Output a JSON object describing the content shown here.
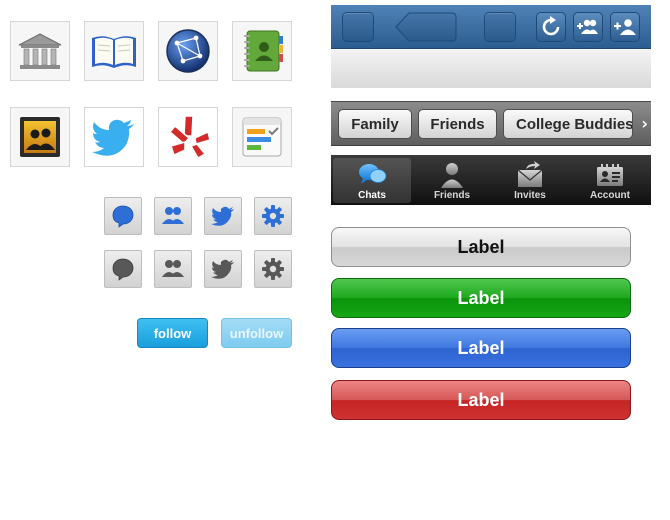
{
  "follow_buttons": {
    "follow": "follow",
    "unfollow": "unfollow"
  },
  "segments": [
    "Family",
    "Friends",
    "College Buddies"
  ],
  "tabs": [
    "Chats",
    "Friends",
    "Invites",
    "Account"
  ],
  "buttons": {
    "gray": "Label",
    "green": "Label",
    "blue": "Label",
    "red": "Label"
  },
  "colors": {
    "nav_blue": "#3a6ca0",
    "follow_blue": "#1a9fdd",
    "green": "#1ea81e",
    "blue": "#3f77e0",
    "red": "#c52424"
  },
  "icons": {
    "app_row_1": [
      "bank-icon",
      "book-icon",
      "network-globe-icon",
      "address-book-icon"
    ],
    "app_row_2": [
      "contacts-photo-icon",
      "twitter-bird-icon",
      "yelp-icon",
      "options-settings-icon"
    ],
    "small_row_blue": [
      "chat-bubble-icon",
      "users-icon",
      "twitter-bird-icon",
      "gear-icon"
    ],
    "small_row_gray": [
      "chat-bubble-icon",
      "users-icon",
      "twitter-bird-icon",
      "gear-icon"
    ],
    "nav": [
      "refresh-icon",
      "add-group-icon",
      "add-user-icon"
    ],
    "tabs": [
      "chat-bubbles-icon",
      "person-icon",
      "envelope-icon",
      "id-card-icon"
    ]
  }
}
